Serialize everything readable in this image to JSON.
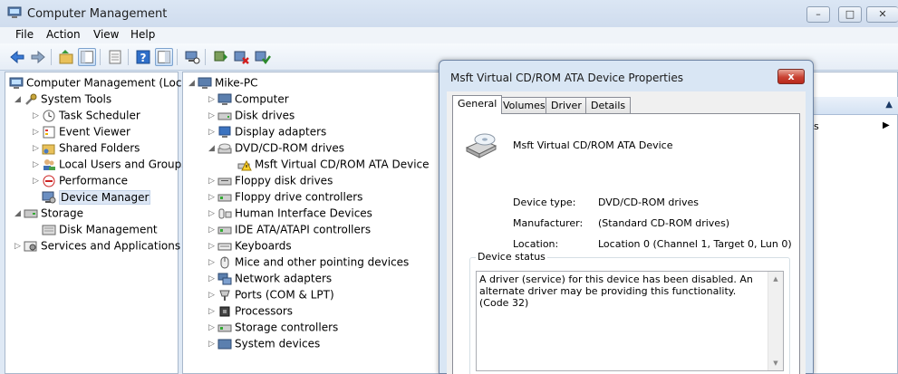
{
  "window": {
    "title": "Computer Management"
  },
  "menu": [
    "File",
    "Action",
    "View",
    "Help"
  ],
  "left_tree": {
    "root": "Computer Management (Local",
    "items": [
      {
        "label": "System Tools"
      },
      {
        "label": "Task Scheduler"
      },
      {
        "label": "Event Viewer"
      },
      {
        "label": "Shared Folders"
      },
      {
        "label": "Local Users and Groups"
      },
      {
        "label": "Performance"
      },
      {
        "label": "Device Manager"
      },
      {
        "label": "Storage"
      },
      {
        "label": "Disk Management"
      },
      {
        "label": "Services and Applications"
      }
    ]
  },
  "device_tree": {
    "root": "Mike-PC",
    "items": [
      {
        "label": "Computer"
      },
      {
        "label": "Disk drives"
      },
      {
        "label": "Display adapters"
      },
      {
        "label": "DVD/CD-ROM drives"
      },
      {
        "label": "Msft Virtual CD/ROM ATA Device"
      },
      {
        "label": "Floppy disk drives"
      },
      {
        "label": "Floppy drive controllers"
      },
      {
        "label": "Human Interface Devices"
      },
      {
        "label": "IDE ATA/ATAPI controllers"
      },
      {
        "label": "Keyboards"
      },
      {
        "label": "Mice and other pointing devices"
      },
      {
        "label": "Network adapters"
      },
      {
        "label": "Ports (COM & LPT)"
      },
      {
        "label": "Processors"
      },
      {
        "label": "Storage controllers"
      },
      {
        "label": "System devices"
      }
    ]
  },
  "actions": {
    "partial_label": "s"
  },
  "dialog": {
    "title": "Msft Virtual CD/ROM ATA Device Properties",
    "close_label": "x",
    "tabs": [
      "General",
      "Volumes",
      "Driver",
      "Details"
    ],
    "device_name": "Msft Virtual CD/ROM ATA Device",
    "props": [
      {
        "label": "Device type:",
        "value": "DVD/CD-ROM drives"
      },
      {
        "label": "Manufacturer:",
        "value": "(Standard CD-ROM drives)"
      },
      {
        "label": "Location:",
        "value": "Location 0 (Channel 1, Target 0, Lun 0)"
      }
    ],
    "status_group_label": "Device status",
    "status_text": "A driver (service) for this device has been disabled.  An alternate driver may be providing this functionality. (Code 32)"
  }
}
